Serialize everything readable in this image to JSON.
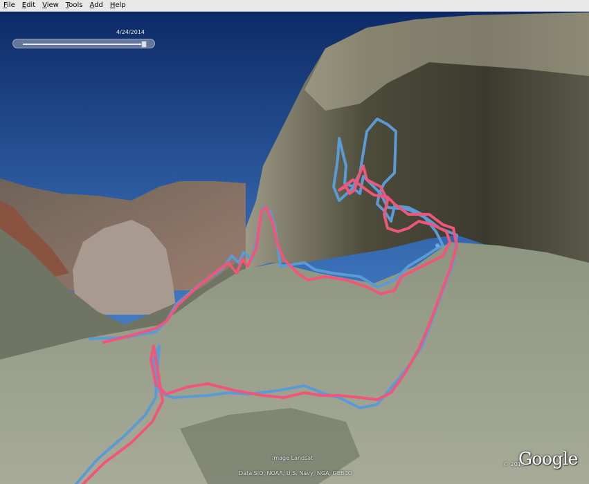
{
  "menu": {
    "items": [
      "File",
      "Edit",
      "View",
      "Tools",
      "Add",
      "Help"
    ]
  },
  "time_slider": {
    "date": "4/24/2014",
    "position": 0.97
  },
  "credits": {
    "image": "Image Landsat",
    "data": "Data SIO, NOAA, U.S. Navy, NGA, GEBCO",
    "year": "© 2010",
    "logo": "Google"
  },
  "tracks": {
    "blue_color": "#5b9bd5",
    "pink_color": "#f0557a"
  }
}
